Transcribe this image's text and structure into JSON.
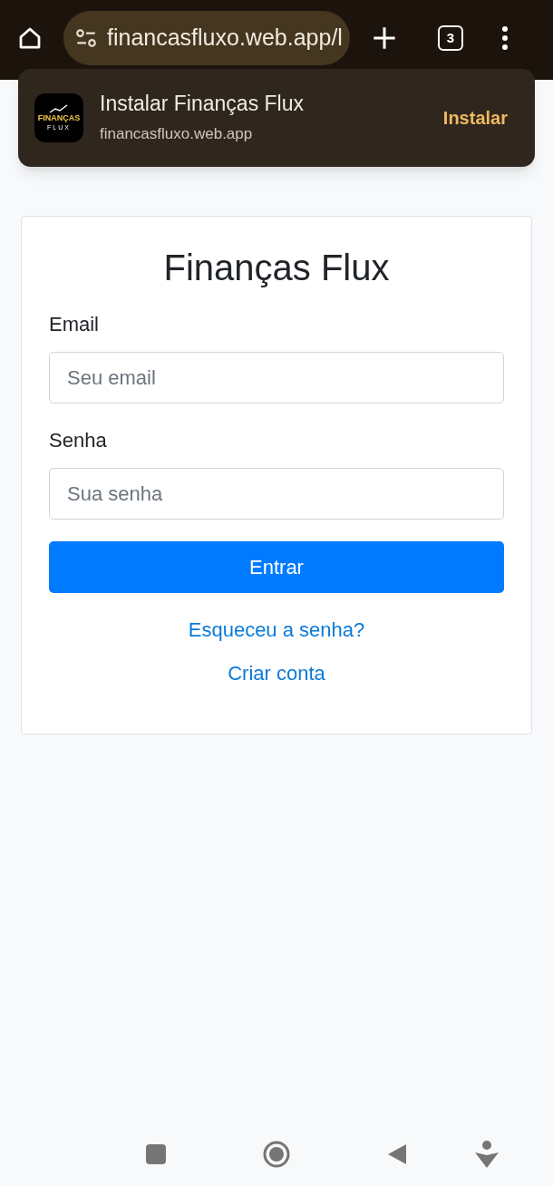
{
  "browser": {
    "url": "financasfluxo.web.app/l",
    "tab_count": "3"
  },
  "install_banner": {
    "app_icon_title": "FINANÇAS",
    "app_icon_subtitle": "FLUX",
    "title": "Instalar Finanças Flux",
    "domain": "financasfluxo.web.app",
    "action": "Instalar"
  },
  "login": {
    "title": "Finanças Flux",
    "fields": [
      {
        "label": "Email",
        "placeholder": "Seu email"
      },
      {
        "label": "Senha",
        "placeholder": "Sua senha"
      }
    ],
    "submit": "Entrar",
    "links": [
      "Esqueceu a senha?",
      "Criar conta"
    ]
  }
}
